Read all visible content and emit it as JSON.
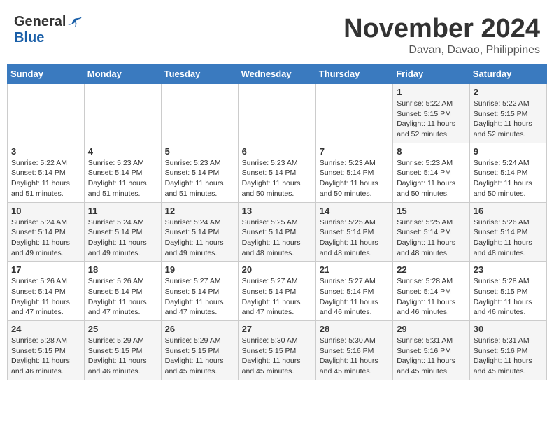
{
  "header": {
    "logo_general": "General",
    "logo_blue": "Blue",
    "main_title": "November 2024",
    "subtitle": "Davan, Davao, Philippines"
  },
  "weekdays": [
    "Sunday",
    "Monday",
    "Tuesday",
    "Wednesday",
    "Thursday",
    "Friday",
    "Saturday"
  ],
  "weeks": [
    [
      {
        "day": "",
        "info": ""
      },
      {
        "day": "",
        "info": ""
      },
      {
        "day": "",
        "info": ""
      },
      {
        "day": "",
        "info": ""
      },
      {
        "day": "",
        "info": ""
      },
      {
        "day": "1",
        "info": "Sunrise: 5:22 AM\nSunset: 5:15 PM\nDaylight: 11 hours\nand 52 minutes."
      },
      {
        "day": "2",
        "info": "Sunrise: 5:22 AM\nSunset: 5:15 PM\nDaylight: 11 hours\nand 52 minutes."
      }
    ],
    [
      {
        "day": "3",
        "info": "Sunrise: 5:22 AM\nSunset: 5:14 PM\nDaylight: 11 hours\nand 51 minutes."
      },
      {
        "day": "4",
        "info": "Sunrise: 5:23 AM\nSunset: 5:14 PM\nDaylight: 11 hours\nand 51 minutes."
      },
      {
        "day": "5",
        "info": "Sunrise: 5:23 AM\nSunset: 5:14 PM\nDaylight: 11 hours\nand 51 minutes."
      },
      {
        "day": "6",
        "info": "Sunrise: 5:23 AM\nSunset: 5:14 PM\nDaylight: 11 hours\nand 50 minutes."
      },
      {
        "day": "7",
        "info": "Sunrise: 5:23 AM\nSunset: 5:14 PM\nDaylight: 11 hours\nand 50 minutes."
      },
      {
        "day": "8",
        "info": "Sunrise: 5:23 AM\nSunset: 5:14 PM\nDaylight: 11 hours\nand 50 minutes."
      },
      {
        "day": "9",
        "info": "Sunrise: 5:24 AM\nSunset: 5:14 PM\nDaylight: 11 hours\nand 50 minutes."
      }
    ],
    [
      {
        "day": "10",
        "info": "Sunrise: 5:24 AM\nSunset: 5:14 PM\nDaylight: 11 hours\nand 49 minutes."
      },
      {
        "day": "11",
        "info": "Sunrise: 5:24 AM\nSunset: 5:14 PM\nDaylight: 11 hours\nand 49 minutes."
      },
      {
        "day": "12",
        "info": "Sunrise: 5:24 AM\nSunset: 5:14 PM\nDaylight: 11 hours\nand 49 minutes."
      },
      {
        "day": "13",
        "info": "Sunrise: 5:25 AM\nSunset: 5:14 PM\nDaylight: 11 hours\nand 48 minutes."
      },
      {
        "day": "14",
        "info": "Sunrise: 5:25 AM\nSunset: 5:14 PM\nDaylight: 11 hours\nand 48 minutes."
      },
      {
        "day": "15",
        "info": "Sunrise: 5:25 AM\nSunset: 5:14 PM\nDaylight: 11 hours\nand 48 minutes."
      },
      {
        "day": "16",
        "info": "Sunrise: 5:26 AM\nSunset: 5:14 PM\nDaylight: 11 hours\nand 48 minutes."
      }
    ],
    [
      {
        "day": "17",
        "info": "Sunrise: 5:26 AM\nSunset: 5:14 PM\nDaylight: 11 hours\nand 47 minutes."
      },
      {
        "day": "18",
        "info": "Sunrise: 5:26 AM\nSunset: 5:14 PM\nDaylight: 11 hours\nand 47 minutes."
      },
      {
        "day": "19",
        "info": "Sunrise: 5:27 AM\nSunset: 5:14 PM\nDaylight: 11 hours\nand 47 minutes."
      },
      {
        "day": "20",
        "info": "Sunrise: 5:27 AM\nSunset: 5:14 PM\nDaylight: 11 hours\nand 47 minutes."
      },
      {
        "day": "21",
        "info": "Sunrise: 5:27 AM\nSunset: 5:14 PM\nDaylight: 11 hours\nand 46 minutes."
      },
      {
        "day": "22",
        "info": "Sunrise: 5:28 AM\nSunset: 5:14 PM\nDaylight: 11 hours\nand 46 minutes."
      },
      {
        "day": "23",
        "info": "Sunrise: 5:28 AM\nSunset: 5:15 PM\nDaylight: 11 hours\nand 46 minutes."
      }
    ],
    [
      {
        "day": "24",
        "info": "Sunrise: 5:28 AM\nSunset: 5:15 PM\nDaylight: 11 hours\nand 46 minutes."
      },
      {
        "day": "25",
        "info": "Sunrise: 5:29 AM\nSunset: 5:15 PM\nDaylight: 11 hours\nand 46 minutes."
      },
      {
        "day": "26",
        "info": "Sunrise: 5:29 AM\nSunset: 5:15 PM\nDaylight: 11 hours\nand 45 minutes."
      },
      {
        "day": "27",
        "info": "Sunrise: 5:30 AM\nSunset: 5:15 PM\nDaylight: 11 hours\nand 45 minutes."
      },
      {
        "day": "28",
        "info": "Sunrise: 5:30 AM\nSunset: 5:16 PM\nDaylight: 11 hours\nand 45 minutes."
      },
      {
        "day": "29",
        "info": "Sunrise: 5:31 AM\nSunset: 5:16 PM\nDaylight: 11 hours\nand 45 minutes."
      },
      {
        "day": "30",
        "info": "Sunrise: 5:31 AM\nSunset: 5:16 PM\nDaylight: 11 hours\nand 45 minutes."
      }
    ]
  ]
}
